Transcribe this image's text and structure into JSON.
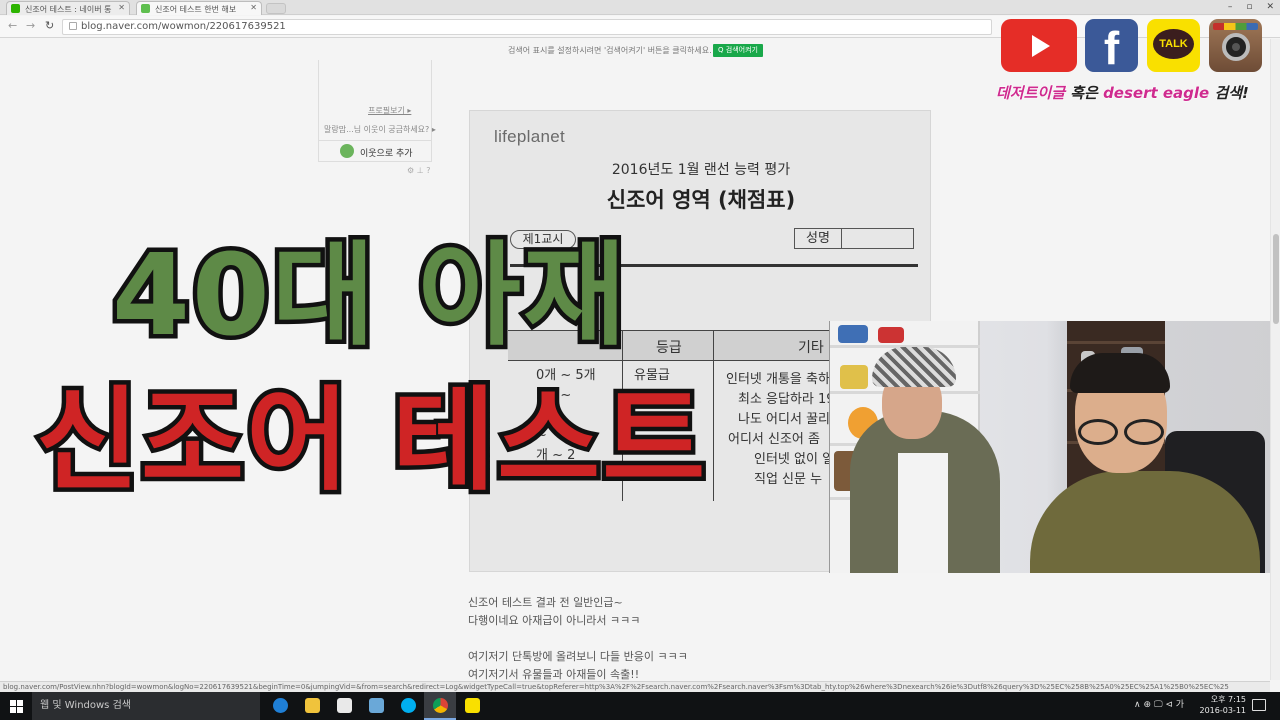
{
  "browser": {
    "tabs": [
      {
        "title": "신조어 테스트 : 네이버 통",
        "active": false
      },
      {
        "title": "신조어 테스트 한번 해보",
        "active": true
      }
    ],
    "url": "blog.naver.com/wowmon/220617639521",
    "window_controls": [
      "–",
      "▫",
      "✕"
    ]
  },
  "page": {
    "search_notice": "검색어 표시를 설정하시려면 '검색어켜기' 버튼을 클릭하세요.",
    "search_toggle": "Q 검색어켜기",
    "profile": {
      "link1": "프로필보기 ▸",
      "link2": "말랑맘...님 이웃이 궁금하세요? ▸",
      "add_friend": "이웃으로 추가",
      "tiny": "⚙ ⊥ ?"
    },
    "doc": {
      "logo": "lifeplanet",
      "title1": "2016년도 1월 랜선 능력 평가",
      "title2": "신조어 영역 (채점표)",
      "class": "제1교시",
      "name_label": "성명",
      "table": {
        "headers": [
          "",
          "등급",
          "기타"
        ],
        "col1": [
          "0개 ~ 5개",
          "5개 ~",
          "1",
          "~",
          "개 ~ 2",
          "~"
        ],
        "col2": [
          "유물급",
          "",
          "",
          "",
          ""
        ],
        "col3": [
          "인터넷 개통을 축하",
          "최소 응답하라 19",
          "나도 어디서 꿀리",
          "어디서 신조어 좀",
          "인터넷 없이 일",
          "직업 신문 누"
        ]
      }
    },
    "overlay": {
      "line1": "40대 아재",
      "line2": "신조어 테스트"
    },
    "social": {
      "facebook": "f",
      "kakao": "TALK",
      "cta_part1": "데저트이글",
      "cta_part2": " 혹은 ",
      "cta_part3": "desert eagle",
      "cta_part4": " 검색!",
      "icons": [
        "youtube-icon",
        "facebook-icon",
        "kakaotalk-icon",
        "instagram-icon"
      ]
    },
    "blog_lines": [
      "신조어 테스트 결과 전 일반인급~",
      "다행이네요 아재급이 아니라서 ㅋㅋㅋ",
      "",
      "여기저기 단톡방에 올려보니 다들 반응이 ㅋㅋㅋ",
      "여기저기서 유물들과 아재들이 속출!!"
    ]
  },
  "status_url": "blog.naver.com/PostView.nhn?blogId=wowmon&logNo=220617639521&beginTime=0&jumpingVid=&from=search&redirect=Log&widgetTypeCall=true&topReferer=http%3A%2F%2Fsearch.naver.com%2Fsearch.naver%3Fsm%3Dtab_hty.top%26where%3Dnexearch%26ie%3Dutf8%26query%3D%25EC%258B%25A0%25EC%25A1%25B0%25EC%25",
  "taskbar": {
    "search_placeholder": "웹 및 Windows 검색",
    "clock_time": "오후 7:15",
    "clock_date": "2016-03-11",
    "tray": "∧ ⊕ 🖵 ⊲ 가"
  }
}
